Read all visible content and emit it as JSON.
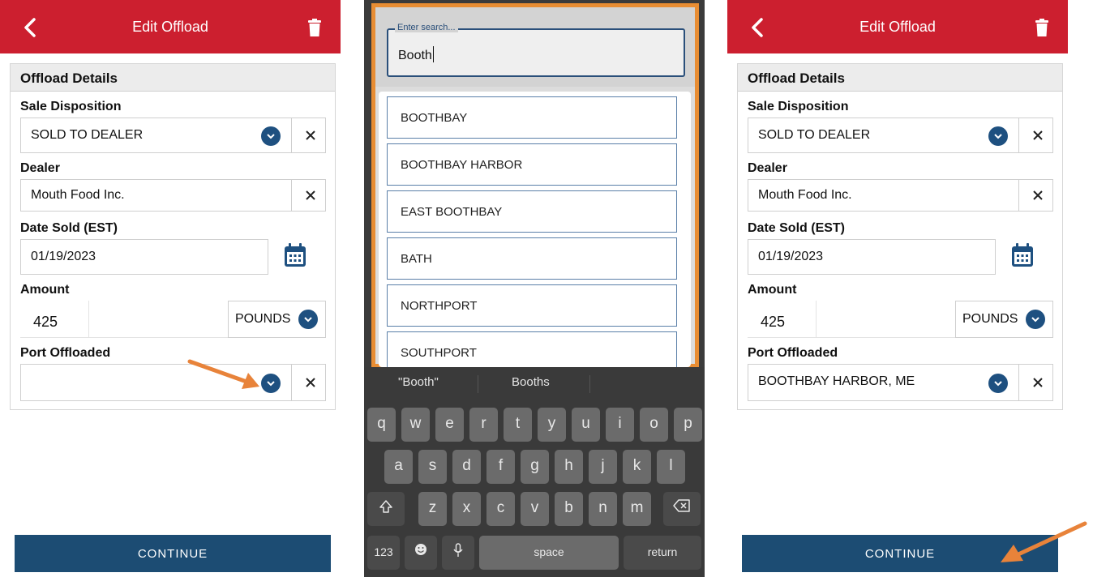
{
  "screens": {
    "left": {
      "title": "Edit Offload",
      "section_title": "Offload Details",
      "sale_disposition_label": "Sale Disposition",
      "sale_disposition_value": "SOLD TO DEALER",
      "dealer_label": "Dealer",
      "dealer_value": "Mouth Food Inc.",
      "date_label": "Date Sold (EST)",
      "date_value": "01/19/2023",
      "amount_label": "Amount",
      "amount_value": "425",
      "unit_value": "POUNDS",
      "port_label": "Port Offloaded",
      "port_value": "",
      "continue_label": "CONTINUE"
    },
    "middle": {
      "search_placeholder": "Enter search...",
      "search_value": "Booth",
      "options": [
        "BOOTHBAY",
        "BOOTHBAY HARBOR",
        "EAST BOOTHBAY",
        "BATH",
        "NORTHPORT",
        "SOUTHPORT"
      ],
      "suggestions": [
        "\"Booth\"",
        "Booths"
      ],
      "keyboard": {
        "row1": [
          "q",
          "w",
          "e",
          "r",
          "t",
          "y",
          "u",
          "i",
          "o",
          "p"
        ],
        "row2": [
          "a",
          "s",
          "d",
          "f",
          "g",
          "h",
          "j",
          "k",
          "l"
        ],
        "row3": [
          "z",
          "x",
          "c",
          "v",
          "b",
          "n",
          "m"
        ],
        "numbers_key": "123",
        "space_key": "space",
        "return_key": "return"
      }
    },
    "right": {
      "title": "Edit Offload",
      "section_title": "Offload Details",
      "sale_disposition_label": "Sale Disposition",
      "sale_disposition_value": "SOLD TO DEALER",
      "dealer_label": "Dealer",
      "dealer_value": "Mouth Food Inc.",
      "date_label": "Date Sold (EST)",
      "date_value": "01/19/2023",
      "amount_label": "Amount",
      "amount_value": "425",
      "unit_value": "POUNDS",
      "port_label": "Port Offloaded",
      "port_value": "BOOTHBAY HARBOR, ME",
      "continue_label": "CONTINUE"
    }
  },
  "colors": {
    "header_red": "#cc1f2f",
    "primary_blue": "#1c4c73",
    "highlight_orange": "#e88d33",
    "annotation_arrow": "#e8833a"
  }
}
